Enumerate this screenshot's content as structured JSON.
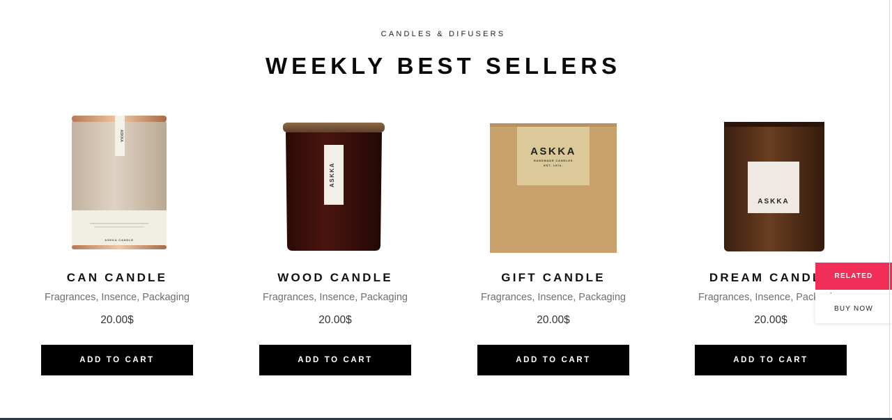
{
  "section": {
    "eyebrow": "CANDLES & DIFUSERS",
    "title": "WEEKLY BEST SELLERS"
  },
  "products": [
    {
      "name": "CAN CANDLE",
      "categories": "Fragrances, Insence, Packaging",
      "price": "20.00$",
      "cta": "ADD TO CART",
      "label_text": "ASKKA",
      "footer_text": "ASKKA CANDLE"
    },
    {
      "name": "WOOD CANDLE",
      "categories": "Fragrances, Insence, Packaging",
      "price": "20.00$",
      "cta": "ADD TO CART",
      "label_text": "ASKKA"
    },
    {
      "name": "GIFT CANDLE",
      "categories": "Fragrances, Insence, Packaging",
      "price": "20.00$",
      "cta": "ADD TO CART",
      "label_text": "ASKKA",
      "label_sub": "HANDMADE CANDLES",
      "label_est": "EST. 1970."
    },
    {
      "name": "DREAM CANDLE",
      "categories": "Fragrances, Insence, Packaging",
      "price": "20.00$",
      "cta": "ADD TO CART",
      "label_text": "ASKKA"
    }
  ],
  "side_tabs": {
    "related": "RELATED",
    "buy_now": "BUY NOW"
  },
  "colors": {
    "accent": "#f02e57",
    "button": "#000000",
    "background": "#ffffff"
  }
}
